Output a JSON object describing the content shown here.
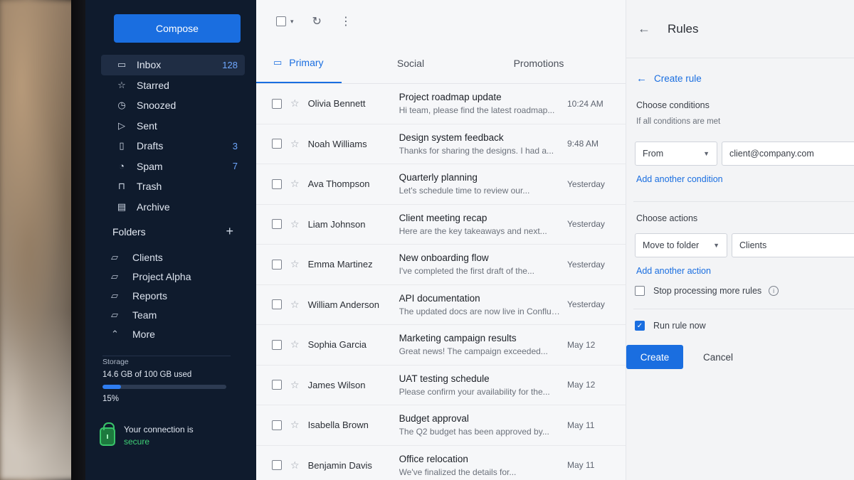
{
  "sidebar": {
    "compose_label": "Compose",
    "items": [
      {
        "label": "Inbox",
        "count": "128",
        "icon": "inbox-icon",
        "glyph": "▭"
      },
      {
        "label": "Starred",
        "count": "",
        "icon": "star-icon",
        "glyph": "☆"
      },
      {
        "label": "Snoozed",
        "count": "",
        "icon": "clock-icon",
        "glyph": "◷"
      },
      {
        "label": "Sent",
        "count": "",
        "icon": "send-icon",
        "glyph": "▷"
      },
      {
        "label": "Drafts",
        "count": "3",
        "icon": "draft-icon",
        "glyph": "▯"
      },
      {
        "label": "Spam",
        "count": "7",
        "icon": "spam-icon",
        "glyph": "◔"
      },
      {
        "label": "Trash",
        "count": "",
        "icon": "trash-icon",
        "glyph": "⊓"
      },
      {
        "label": "Archive",
        "count": "",
        "icon": "archive-icon",
        "glyph": "▤"
      }
    ],
    "folders_title": "Folders",
    "add_folder_glyph": "+",
    "folders": [
      {
        "label": "Clients"
      },
      {
        "label": "Project Alpha"
      },
      {
        "label": "Reports"
      },
      {
        "label": "Team"
      }
    ],
    "more_label": "More",
    "storage": {
      "title": "Storage",
      "used_text": "14.6 GB of 100 GB used",
      "percent_text": "15%",
      "percent": 15
    },
    "secure": {
      "line1": "Your connection is",
      "line2": "secure"
    }
  },
  "mail": {
    "tabs": [
      {
        "label": "Primary"
      },
      {
        "label": "Social"
      },
      {
        "label": "Promotions"
      }
    ],
    "rows": [
      {
        "sender": "Olivia Bennett",
        "subject": "Project roadmap update",
        "preview": "Hi team, please find the latest roadmap...",
        "time": "10:24 AM"
      },
      {
        "sender": "Noah Williams",
        "subject": "Design system feedback",
        "preview": "Thanks for sharing the designs. I had a...",
        "time": "9:48 AM"
      },
      {
        "sender": "Ava Thompson",
        "subject": "Quarterly planning",
        "preview": "Let's schedule time to review our...",
        "time": "Yesterday"
      },
      {
        "sender": "Liam Johnson",
        "subject": "Client meeting recap",
        "preview": "Here are the key takeaways and next...",
        "time": "Yesterday"
      },
      {
        "sender": "Emma Martinez",
        "subject": "New onboarding flow",
        "preview": "I've completed the first draft of the...",
        "time": "Yesterday"
      },
      {
        "sender": "William Anderson",
        "subject": "API documentation",
        "preview": "The updated docs are now live in Confluence...",
        "time": "Yesterday"
      },
      {
        "sender": "Sophia Garcia",
        "subject": "Marketing campaign results",
        "preview": "Great news! The campaign exceeded...",
        "time": "May 12"
      },
      {
        "sender": "James Wilson",
        "subject": "UAT testing schedule",
        "preview": "Please confirm your availability for the...",
        "time": "May 12"
      },
      {
        "sender": "Isabella Brown",
        "subject": "Budget approval",
        "preview": "The Q2 budget has been approved by...",
        "time": "May 11"
      },
      {
        "sender": "Benjamin Davis",
        "subject": "Office relocation",
        "preview": "We've finalized the details for...",
        "time": "May 11"
      }
    ]
  },
  "rules": {
    "title": "Rules",
    "create_rule_label": "Create rule",
    "choose_conditions": "Choose conditions",
    "conditions_sub": "If all conditions are met",
    "condition_field": "From",
    "condition_value": "client@company.com",
    "add_condition": "Add another condition",
    "choose_actions": "Choose actions",
    "action_field": "Move to folder",
    "action_value": "Clients",
    "add_action": "Add another action",
    "stop_processing": "Stop processing more rules",
    "run_rule_now": "Run rule now",
    "create_label": "Create",
    "cancel_label": "Cancel"
  }
}
